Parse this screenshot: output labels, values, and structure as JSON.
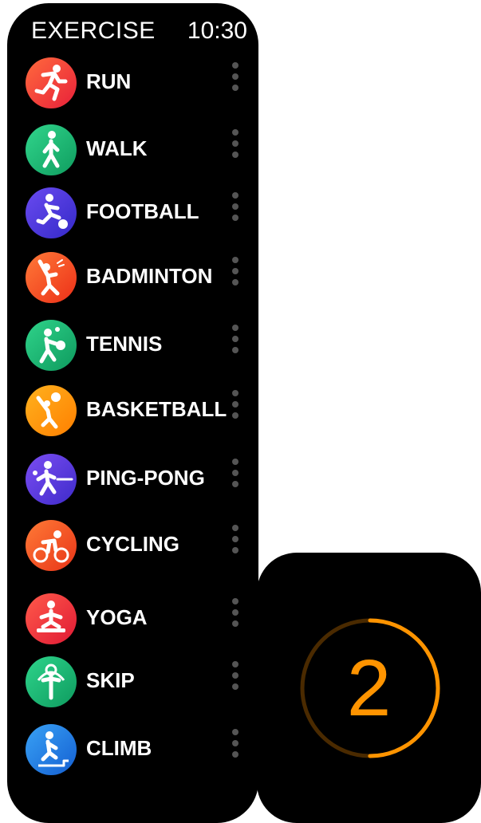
{
  "header": {
    "title": "EXERCISE",
    "time": "10:30"
  },
  "exercises": [
    {
      "label": "RUN",
      "icon": "run-icon",
      "color": "#f0323f",
      "color2": "#ff6a3d"
    },
    {
      "label": "WALK",
      "icon": "walk-icon",
      "color": "#17b06a",
      "color2": "#31d58c"
    },
    {
      "label": "FOOTBALL",
      "icon": "football-icon",
      "color": "#3f36d8",
      "color2": "#6a4bf0"
    },
    {
      "label": "BADMINTON",
      "icon": "badminton-icon",
      "color": "#f5411e",
      "color2": "#ff7a38"
    },
    {
      "label": "TENNIS",
      "icon": "tennis-icon",
      "color": "#16a76a",
      "color2": "#2fd38a"
    },
    {
      "label": "BASKETBALL",
      "icon": "basketball-icon",
      "color": "#ff8a00",
      "color2": "#ffb21e"
    },
    {
      "label": "PING-PONG",
      "icon": "ping-pong-icon",
      "color": "#4b35d6",
      "color2": "#7b4df2"
    },
    {
      "label": "CYCLING",
      "icon": "cycling-icon",
      "color": "#f0461f",
      "color2": "#ff7a36"
    },
    {
      "label": "YOGA",
      "icon": "yoga-icon",
      "color": "#f0283b",
      "color2": "#ff5a4a"
    },
    {
      "label": "SKIP",
      "icon": "skip-icon",
      "color": "#16a86a",
      "color2": "#2ed48b"
    },
    {
      "label": "CLIMB",
      "icon": "climb-icon",
      "color": "#1a6fdc",
      "color2": "#39a2f5"
    }
  ],
  "countdown": {
    "value": "2",
    "progress": 0.5,
    "accent": "#ff9400",
    "track": "#4a2a00"
  }
}
